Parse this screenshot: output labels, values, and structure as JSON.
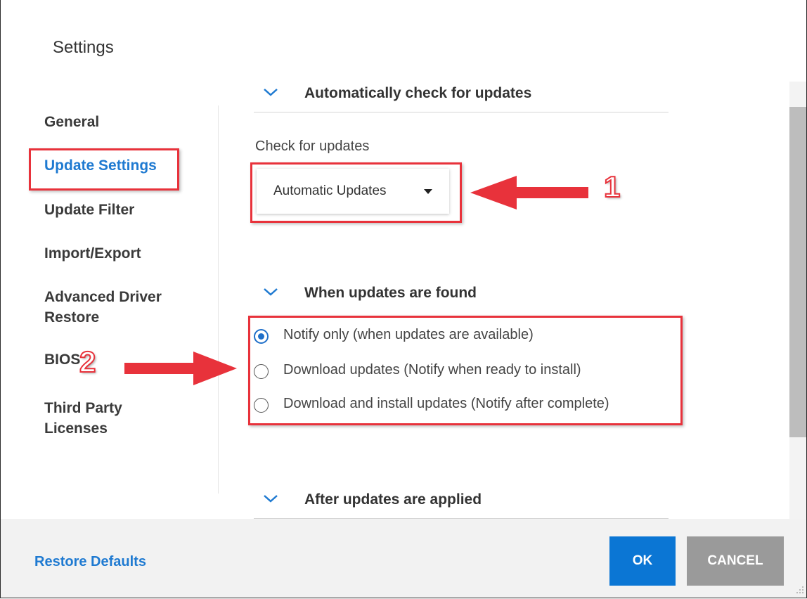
{
  "dialog": {
    "title": "Settings"
  },
  "sidebar": {
    "items": [
      {
        "label": "General",
        "active": false
      },
      {
        "label": "Update Settings",
        "active": true
      },
      {
        "label": "Update Filter",
        "active": false
      },
      {
        "label": "Import/Export",
        "active": false
      },
      {
        "label": "Advanced Driver Restore",
        "active": false
      },
      {
        "label": "BIOS",
        "active": false
      },
      {
        "label": "Third Party Licenses",
        "active": false
      }
    ]
  },
  "content": {
    "sections": [
      {
        "header": "Automatically check for updates"
      },
      {
        "header": "When updates are found"
      },
      {
        "header": "After updates are applied"
      }
    ],
    "check_for_updates": {
      "label": "Check for updates",
      "selected": "Automatic Updates"
    },
    "when_found_options": [
      {
        "label": "Notify only (when updates are available)",
        "checked": true
      },
      {
        "label": "Download updates (Notify when ready to install)",
        "checked": false
      },
      {
        "label": "Download and install updates (Notify after complete)",
        "checked": false
      }
    ]
  },
  "annotations": {
    "callout_1": "1",
    "callout_2": "2"
  },
  "footer": {
    "restore_defaults": "Restore Defaults",
    "ok": "OK",
    "cancel": "CANCEL"
  },
  "colors": {
    "accent": "#1f7ad1",
    "ok_button": "#0b76d4",
    "cancel_button": "#9a9a9a",
    "annotation_red": "#e8323b"
  },
  "icons": {
    "section_toggle": "chevron-down-icon",
    "dropdown": "caret-down-icon",
    "resize": "resize-grip-icon"
  }
}
